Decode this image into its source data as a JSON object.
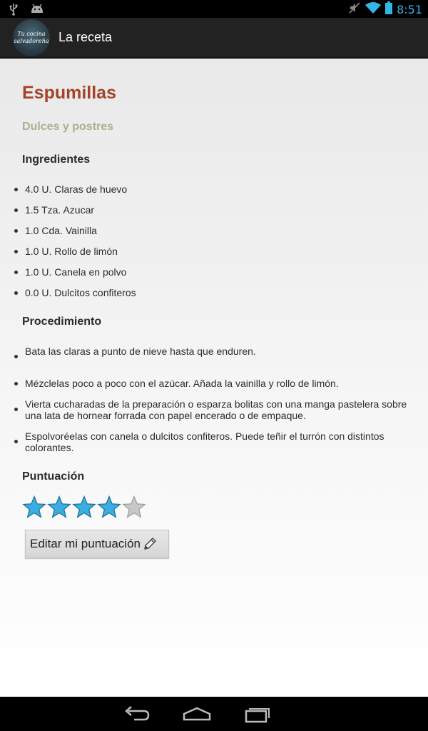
{
  "status_bar": {
    "time": "8:51",
    "icons": [
      "usb-icon",
      "android-icon",
      "mute-icon",
      "wifi-icon",
      "battery-icon"
    ]
  },
  "action_bar": {
    "logo_line1": "Tu cocina",
    "logo_line2": "salvadoreña",
    "title": "La receta"
  },
  "recipe": {
    "title": "Espumillas",
    "category": "Dulces y postres",
    "ingredients_heading": "Ingredientes",
    "ingredients": [
      "4.0 U. Claras de huevo",
      "1.5 Tza. Azucar",
      "1.0 Cda. Vainilla",
      "1.0 U. Rollo de limón",
      "1.0 U. Canela en polvo",
      "0.0 U. Dulcitos confiteros"
    ],
    "procedure_heading": "Procedimiento",
    "steps": [
      "Bata las claras a punto de nieve hasta que enduren.",
      "Mézclelas poco a poco con el azúcar. Añada la vainilla y rollo de limón.",
      "Vierta cucharadas de la preparación o esparza bolitas con una manga pastelera sobre una lata de hornear forrada con papel encerado o de empaque.",
      "Espolvoréelas con canela o dulcitos confiteros. Puede teñir el turrón con distintos colorantes."
    ],
    "rating_heading": "Puntuación",
    "rating": {
      "value": 4,
      "max": 5
    },
    "edit_button_label": "Editar mi puntuación"
  },
  "colors": {
    "title": "#a2432a",
    "category": "#a9b191",
    "star_filled": "#3aaee0",
    "star_empty": "#c8c8c8",
    "status_accent": "#33b5e5"
  }
}
